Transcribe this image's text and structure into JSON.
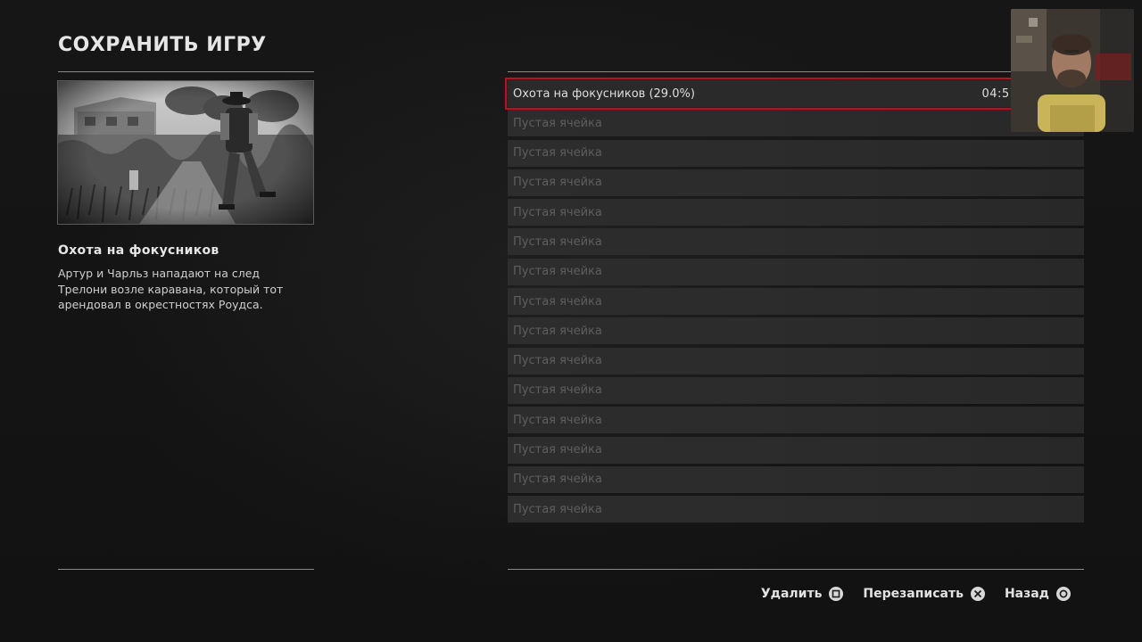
{
  "page": {
    "title": "СОХРАНИТЬ ИГРУ"
  },
  "mission": {
    "title": "Охота на фокусников",
    "description": "Артур и Чарльз нападают на след Трелони возле каравана, который тот арендовал в окрестностях Роудса."
  },
  "slots": [
    {
      "label": "Охота на фокусников (29.0%)",
      "time": "04:57 26 07 23",
      "filled": true
    },
    {
      "label": "Пустая ячейка"
    },
    {
      "label": "Пустая ячейка"
    },
    {
      "label": "Пустая ячейка"
    },
    {
      "label": "Пустая ячейка"
    },
    {
      "label": "Пустая ячейка"
    },
    {
      "label": "Пустая ячейка"
    },
    {
      "label": "Пустая ячейка"
    },
    {
      "label": "Пустая ячейка"
    },
    {
      "label": "Пустая ячейка"
    },
    {
      "label": "Пустая ячейка"
    },
    {
      "label": "Пустая ячейка"
    },
    {
      "label": "Пустая ячейка"
    },
    {
      "label": "Пустая ячейка"
    },
    {
      "label": "Пустая ячейка"
    }
  ],
  "hints": {
    "delete_label": "Удалить",
    "delete_icon": "square-button-icon",
    "overwrite_label": "Перезаписать",
    "overwrite_icon": "cross-button-icon",
    "back_label": "Назад",
    "back_icon": "circle-button-icon"
  },
  "colors": {
    "selection": "#b5141d",
    "background": "#141414",
    "slot": "#2b2b2b",
    "empty_text": "#5e5e5e"
  }
}
